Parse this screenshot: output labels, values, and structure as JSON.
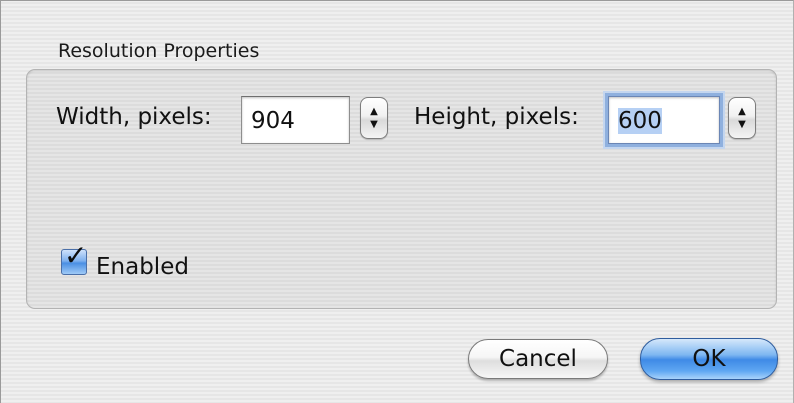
{
  "dialog": {
    "group_title": "Resolution Properties",
    "width_label": "Width, pixels:",
    "width_value": "904",
    "height_label": "Height, pixels:",
    "height_value": "600",
    "height_value_first_char": "6",
    "height_value_rest": "00",
    "enabled_label": "Enabled",
    "enabled_checked": true,
    "cancel_label": "Cancel",
    "ok_label": "OK"
  },
  "icons": {
    "stepper_up": "triangle-up",
    "stepper_down": "triangle-down",
    "checkmark": "checkmark"
  },
  "colors": {
    "focus_ring": "#8fb0de",
    "default_button": "#3f8ae6",
    "checkbox_fill": "#4b8fe3"
  }
}
